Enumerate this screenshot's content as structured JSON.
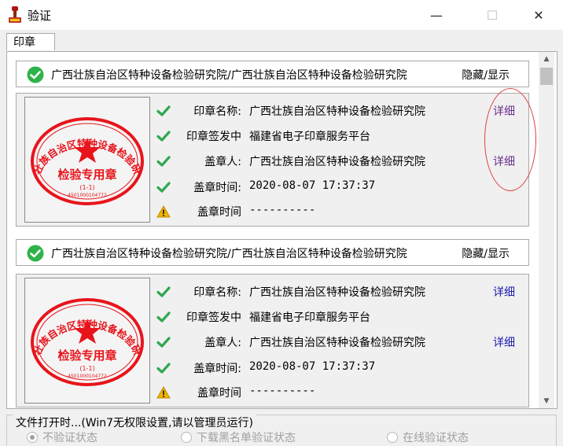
{
  "window": {
    "title": "验证",
    "minimize": "—",
    "maximize": "☐",
    "close": "✕"
  },
  "tab": {
    "label": "印章"
  },
  "signatures": [
    {
      "header": "广西壮族自治区特种设备检验研究院/广西壮族自治区特种设备检验研究院",
      "toggle": "隐藏/显示",
      "seal": {
        "arc_text": "广西壮族自治区特种设备检验研究院",
        "center_text": "检验专用章",
        "serial": "(1-1)",
        "digits": "4501000104772"
      },
      "rows": [
        {
          "status": "ok",
          "label": "印章名称:",
          "value": "广西壮族自治区特种设备检验研究院",
          "link": "详细",
          "visited": true
        },
        {
          "status": "ok",
          "label": "印章签发中",
          "value": "福建省电子印章服务平台",
          "link": ""
        },
        {
          "status": "ok",
          "label": "盖章人:",
          "value": "广西壮族自治区特种设备检验研究院",
          "link": "详细",
          "visited": true
        },
        {
          "status": "ok",
          "label": "盖章时间:",
          "value": "2020-08-07 17:37:37",
          "link": "",
          "mono": true
        },
        {
          "status": "warn",
          "label": "盖章时间",
          "value": "----------",
          "link": "",
          "mono": true
        }
      ]
    },
    {
      "header": "广西壮族自治区特种设备检验研究院/广西壮族自治区特种设备检验研究院",
      "toggle": "隐藏/显示",
      "seal": {
        "arc_text": "广西壮族自治区特种设备检验研究院",
        "center_text": "检验专用章",
        "serial": "(1-1)",
        "digits": "4501000104772"
      },
      "rows": [
        {
          "status": "ok",
          "label": "印章名称:",
          "value": "广西壮族自治区特种设备检验研究院",
          "link": "详细"
        },
        {
          "status": "ok",
          "label": "印章签发中",
          "value": "福建省电子印章服务平台",
          "link": ""
        },
        {
          "status": "ok",
          "label": "盖章人:",
          "value": "广西壮族自治区特种设备检验研究院",
          "link": "详细"
        },
        {
          "status": "ok",
          "label": "盖章时间:",
          "value": "2020-08-07 17:37:37",
          "link": "",
          "mono": true
        },
        {
          "status": "warn",
          "label": "盖章时间",
          "value": "----------",
          "link": "",
          "mono": true
        }
      ]
    }
  ],
  "file_open": {
    "label": "文件打开时...(Win7无权限设置,请以管理员运行)",
    "options": [
      {
        "label": "不验证状态",
        "selected": true
      },
      {
        "label": "下载黑名单验证状态",
        "selected": false
      },
      {
        "label": "在线验证状态",
        "selected": false
      }
    ]
  },
  "colors": {
    "seal_red": "#e8141b",
    "link": "#1a1ab0",
    "check_green": "#2fa84f",
    "warn_yellow": "#f2b200"
  }
}
